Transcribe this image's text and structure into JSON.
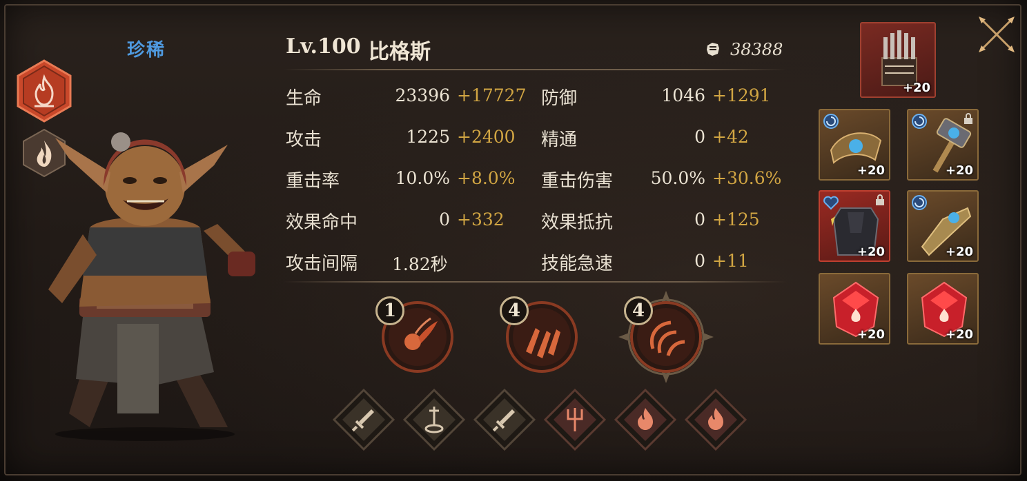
{
  "hero": {
    "rarity": "珍稀",
    "level": "Lv.100",
    "name": "比格斯",
    "power": "38388"
  },
  "stats": {
    "hp": {
      "label": "生命",
      "base": "23396",
      "bonus": "+17727"
    },
    "defense": {
      "label": "防御",
      "base": "1046",
      "bonus": "+1291"
    },
    "attack": {
      "label": "攻击",
      "base": "1225",
      "bonus": "+2400"
    },
    "mastery": {
      "label": "精通",
      "base": "0",
      "bonus": "+42"
    },
    "crit_rate": {
      "label": "重击率",
      "base": "10.0%",
      "bonus": "+8.0%"
    },
    "crit_damage": {
      "label": "重击伤害",
      "base": "50.0%",
      "bonus": "+30.6%"
    },
    "effect_hit": {
      "label": "效果命中",
      "base": "0",
      "bonus": "+332"
    },
    "effect_res": {
      "label": "效果抵抗",
      "base": "0",
      "bonus": "+125"
    },
    "atk_interval": {
      "label": "攻击间隔",
      "base": "1.82秒",
      "bonus": ""
    },
    "skill_haste": {
      "label": "技能急速",
      "base": "0",
      "bonus": "+11"
    }
  },
  "skills": [
    {
      "level": "1",
      "icon": "fireball-icon"
    },
    {
      "level": "4",
      "icon": "fire-missiles-icon"
    },
    {
      "level": "4",
      "icon": "flame-swirl-icon"
    }
  ],
  "runes": [
    {
      "icon": "sword-icon",
      "color": "#3a3228"
    },
    {
      "icon": "sword-pedestal-icon",
      "color": "#3a3228"
    },
    {
      "icon": "sword-icon",
      "color": "#3a3228"
    },
    {
      "icon": "trident-icon",
      "color": "#4a2a26"
    },
    {
      "icon": "fire-icon",
      "color": "#4a2a26"
    },
    {
      "icon": "fire-icon",
      "color": "#4a2a26"
    }
  ],
  "equipment": {
    "artifact": {
      "icon": "organ-icon",
      "level": "+20"
    },
    "slots": [
      {
        "icon": "bracer-icon",
        "level": "+20",
        "rarity": "gold",
        "locked": false
      },
      {
        "icon": "hammer-icon",
        "level": "+20",
        "rarity": "gold",
        "locked": true
      },
      {
        "icon": "armor-icon",
        "level": "+20",
        "rarity": "red",
        "locked": true
      },
      {
        "icon": "gauntlet-icon",
        "level": "+20",
        "rarity": "gold",
        "locked": false
      },
      {
        "icon": "red-gem-icon",
        "level": "+20",
        "rarity": "gold",
        "locked": false
      },
      {
        "icon": "red-gem-icon",
        "level": "+20",
        "rarity": "gold",
        "locked": false
      }
    ]
  },
  "colors": {
    "bonus": "#d2a643",
    "rarity": "#4f9ae0",
    "element": "#d0532c"
  }
}
